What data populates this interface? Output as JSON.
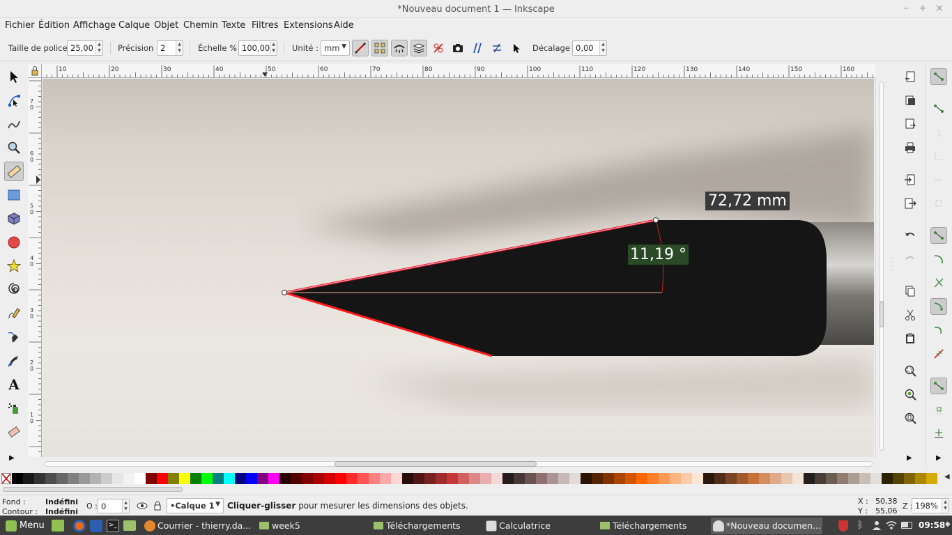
{
  "window": {
    "title": "*Nouveau document 1 — Inkscape"
  },
  "menu": [
    "Fichier",
    "Édition",
    "Affichage",
    "Calque",
    "Objet",
    "Chemin",
    "Texte",
    "Filtres",
    "Extensions",
    "Aide"
  ],
  "tool_controls": {
    "font_size_label": "Taille de police :",
    "font_size_value": "25,00",
    "precision_label": "Précision :",
    "precision_value": "2",
    "scale_label": "Échelle % :",
    "scale_value": "100,000",
    "unit_label": "Unité :",
    "unit_value": "mm",
    "offset_label": "Décalage :",
    "offset_value": "0,00"
  },
  "ruler": {
    "h_labels": [
      "10",
      "20",
      "30",
      "40",
      "50",
      "60",
      "70",
      "80",
      "90",
      "100",
      "110",
      "120",
      "130",
      "140",
      "150",
      "160"
    ],
    "v_labels": [
      "7\n0",
      "6\n0",
      "5\n0",
      "4\n0",
      "3\n0",
      "2\n0",
      "1\n0"
    ]
  },
  "measurement": {
    "length": "72,72 mm",
    "angle": "11,19 °",
    "length_bg": "#3a3a3a",
    "angle_bg": "#2a4a26"
  },
  "status": {
    "fill_label": "Fond :",
    "fill_value": "Indéfini",
    "stroke_label": "Contour :",
    "stroke_value": "Indéfini",
    "opacity_label": "O :",
    "opacity_value": "0",
    "layer": "•Calque 1",
    "hint_bold": "Cliquer-glisser",
    "hint_rest": " pour mesurer les dimensions des objets.",
    "x_label": "X :",
    "x_value": "50,38",
    "y_label": "Y :",
    "y_value": "55,06",
    "zoom_label": "Z :",
    "zoom_value": "198%"
  },
  "taskbar": {
    "menu": "Menu",
    "tasks": [
      {
        "label": "Courrier - thierry.da...",
        "icon": "thunderbird-icon"
      },
      {
        "label": "week5",
        "icon": "folder-icon"
      },
      {
        "label": "Téléchargements",
        "icon": "folder-icon"
      },
      {
        "label": "Calculatrice",
        "icon": "calculator-icon"
      },
      {
        "label": "Téléchargements",
        "icon": "folder-icon"
      },
      {
        "label": "*Nouveau documen...",
        "icon": "inkscape-icon"
      }
    ],
    "clock": "09:58"
  },
  "palette": [
    "#000000",
    "#1a1a1a",
    "#333333",
    "#4d4d4d",
    "#666666",
    "#808080",
    "#999999",
    "#b3b3b3",
    "#cccccc",
    "#e6e6e6",
    "#f2f2f2",
    "#ffffff",
    "#800000",
    "#ff0000",
    "#808000",
    "#ffff00",
    "#008000",
    "#00ff00",
    "#008080",
    "#00ffff",
    "#000080",
    "#0000ff",
    "#800080",
    "#ff00ff",
    "#2b0000",
    "#550000",
    "#800000",
    "#aa0000",
    "#d40000",
    "#ff0000",
    "#ff2a2a",
    "#ff5555",
    "#ff8080",
    "#ffaaaa",
    "#ffd5d5",
    "#280b0b",
    "#501616",
    "#782121",
    "#a02c2c",
    "#c83737",
    "#d35f5f",
    "#de8787",
    "#e9afaf",
    "#f4d7d7",
    "#241c1c",
    "#483737",
    "#6c5353",
    "#916f6f",
    "#ac9393",
    "#c8b7b7",
    "#e3dbdb",
    "#2b1100",
    "#552200",
    "#803300",
    "#aa4400",
    "#d45500",
    "#ff6600",
    "#ff7f2a",
    "#ff9955",
    "#ffb380",
    "#ffccaa",
    "#ffe6d5",
    "#28170b",
    "#502d16",
    "#784421",
    "#a05a2c",
    "#c87137",
    "#d38d5f",
    "#deaa87",
    "#e9c6af",
    "#f4e3d7",
    "#241f1c",
    "#483e37",
    "#6c5d53",
    "#917c6f",
    "#ac9d93",
    "#c8beb7",
    "#e3dedb",
    "#2b2200",
    "#554400",
    "#806600",
    "#aa8800",
    "#d4aa00"
  ]
}
